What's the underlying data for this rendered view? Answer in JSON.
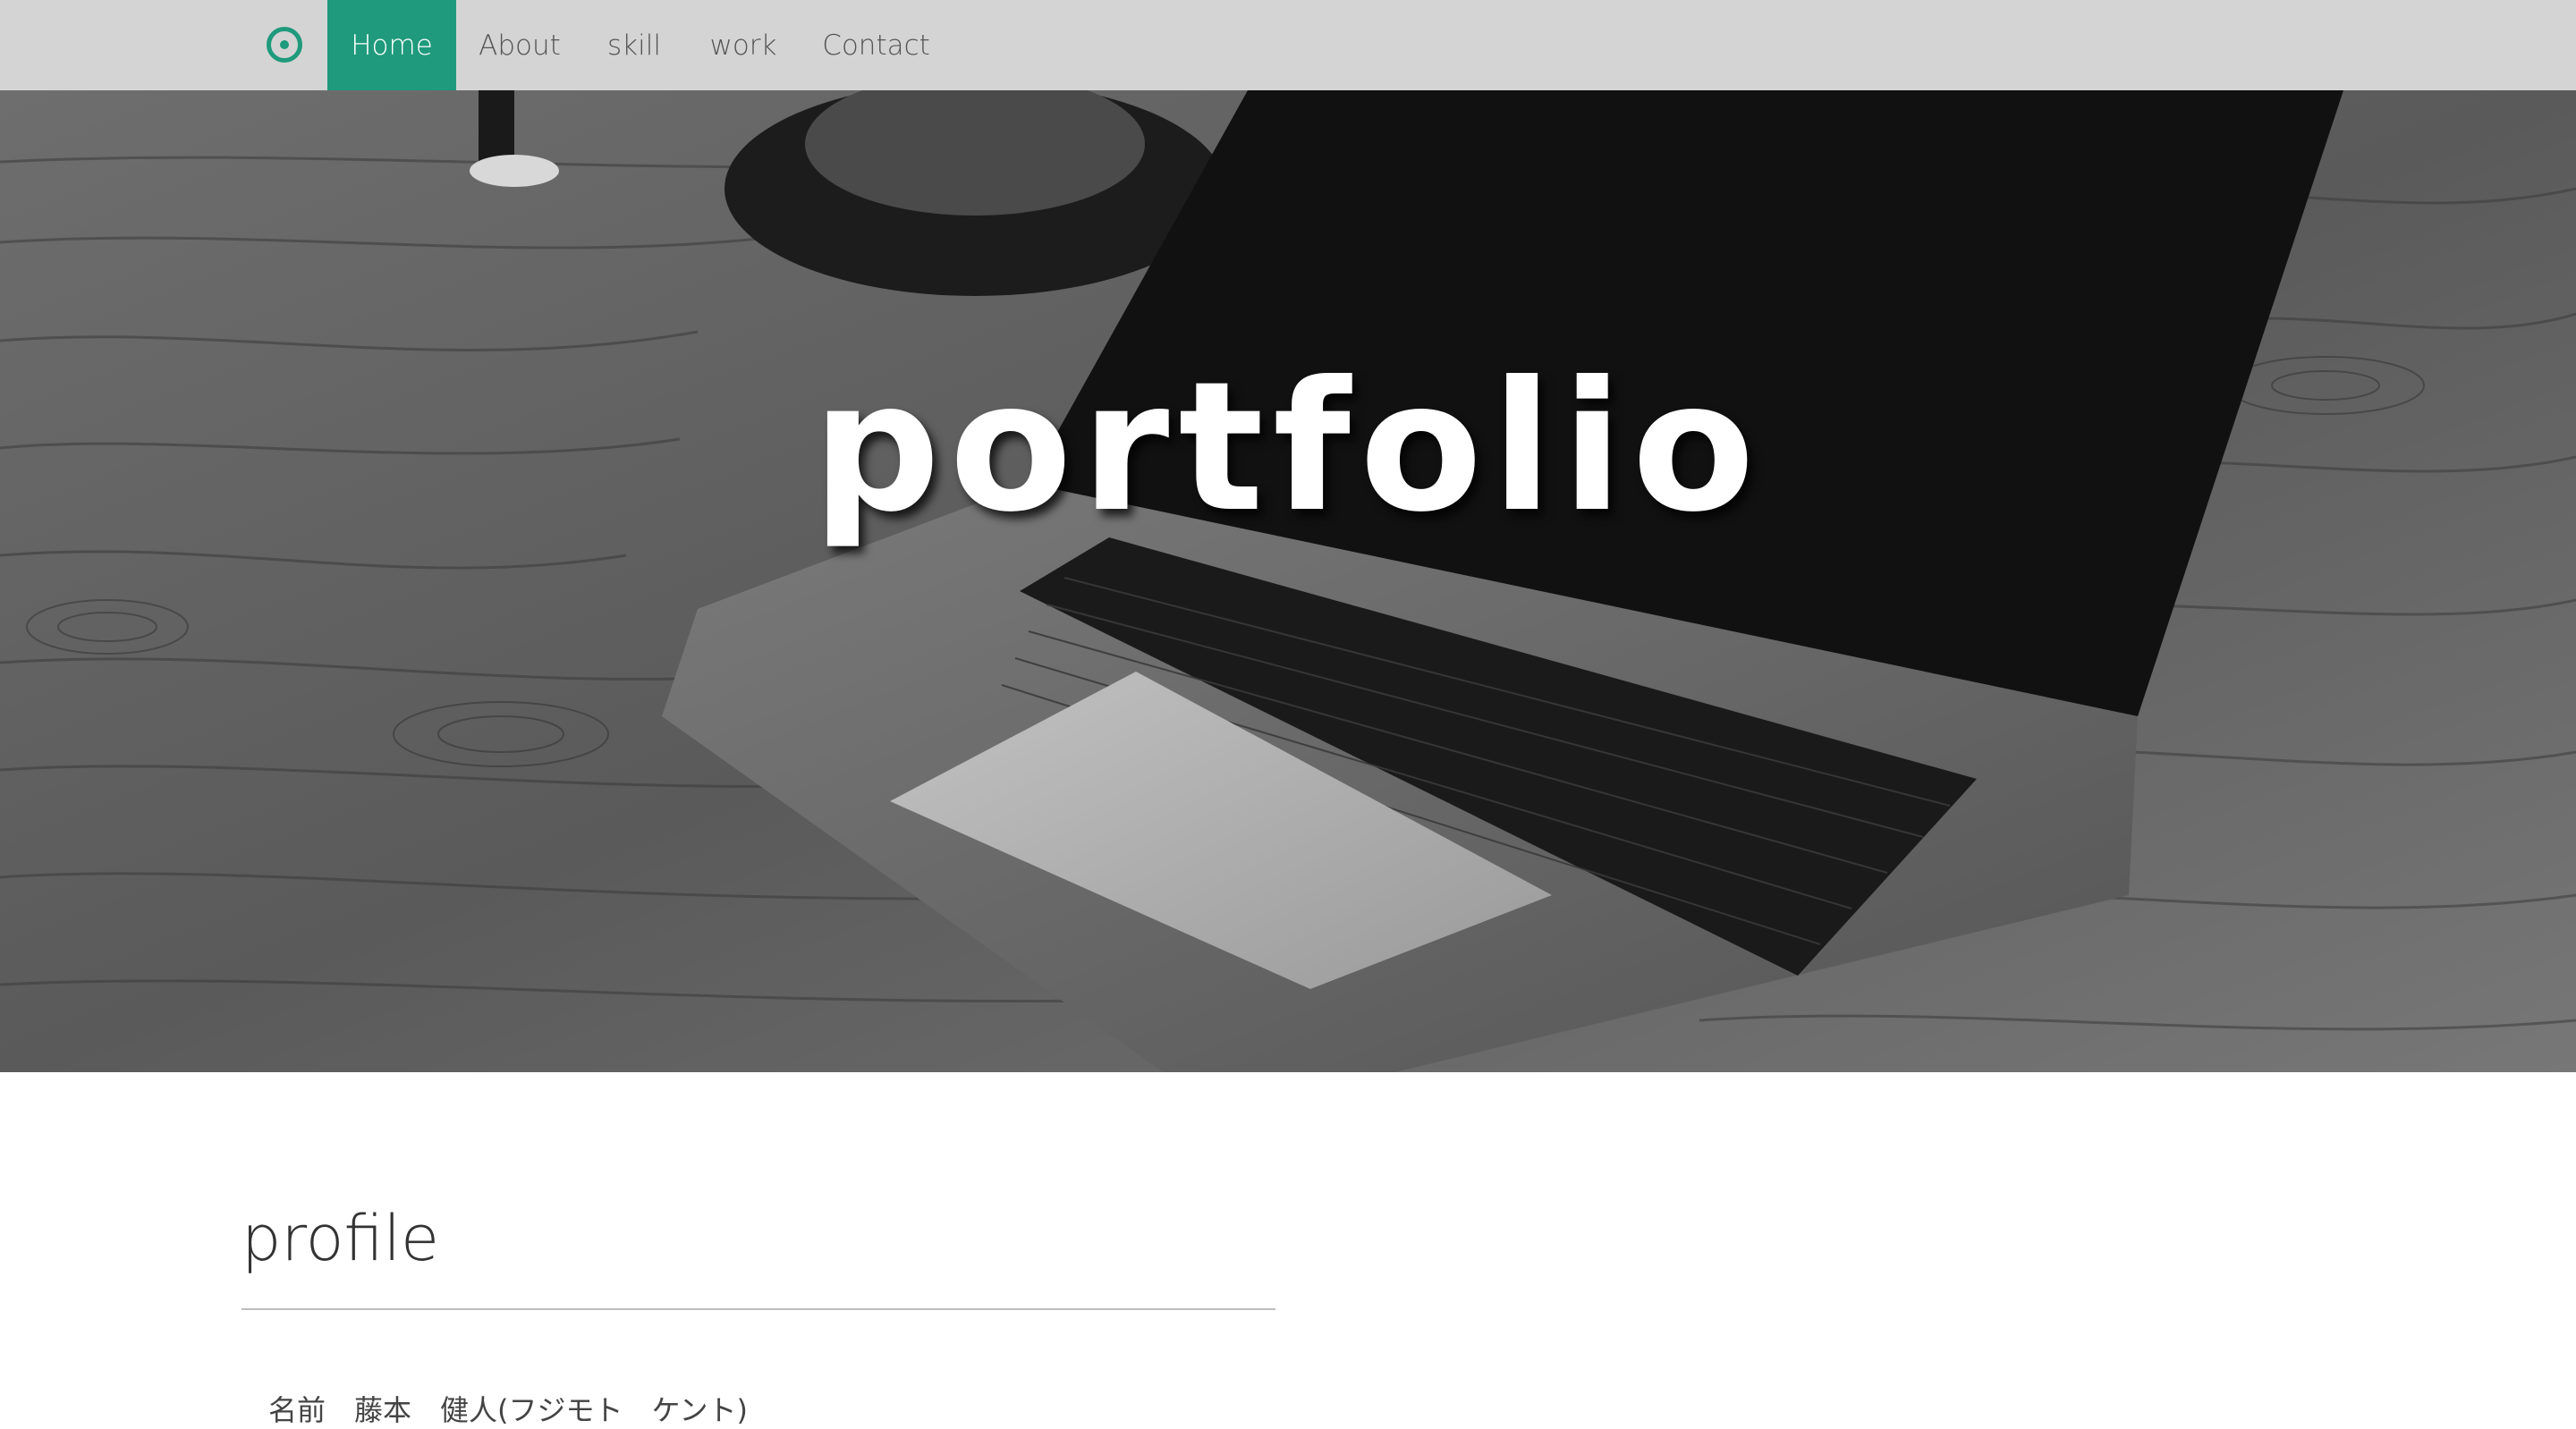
{
  "nav": {
    "brand_icon": "target-icon",
    "items": [
      {
        "label": "Home",
        "active": true
      },
      {
        "label": "About",
        "active": false
      },
      {
        "label": "skill",
        "active": false
      },
      {
        "label": "work",
        "active": false
      },
      {
        "label": "Contact",
        "active": false
      }
    ]
  },
  "hero": {
    "title": "portfolio"
  },
  "profile": {
    "heading": "profile",
    "name_line": "名前　藤本　健人(フジモト　ケント)"
  },
  "colors": {
    "accent": "#1f9a7c",
    "navbar_bg": "#d4d4d4"
  }
}
